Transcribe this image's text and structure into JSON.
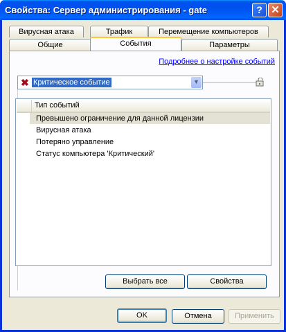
{
  "window": {
    "title": "Свойства: Сервер администрирования - gate",
    "help_label": "?",
    "close_label": "✕"
  },
  "tabs": {
    "back_row": [
      "Вирусная атака",
      "Трафик",
      "Перемещение компьютеров"
    ],
    "front_row": [
      "Общие",
      "События",
      "Параметры"
    ],
    "active": "События"
  },
  "events_page": {
    "settings_link": "Подробнее о настройке событий",
    "severity_combo": {
      "value": "Критическое событие",
      "icon": "critical-x-icon"
    },
    "list": {
      "column_header": "Тип событий",
      "rows": [
        "Превышено ограничение для данной лицензии",
        "Вирусная атака",
        "Потеряно управление",
        "Статус компьютера 'Критический'"
      ],
      "selected_index": 0
    },
    "select_all_label": "Выбрать все",
    "properties_label": "Свойства"
  },
  "dialog_buttons": {
    "ok": "OK",
    "cancel": "Отмена",
    "apply": "Применить"
  },
  "colors": {
    "titlebar": "#0053ee",
    "selection": "#316ac5",
    "active_tab_accent": "#ffc83c",
    "critical": "#a01020"
  }
}
